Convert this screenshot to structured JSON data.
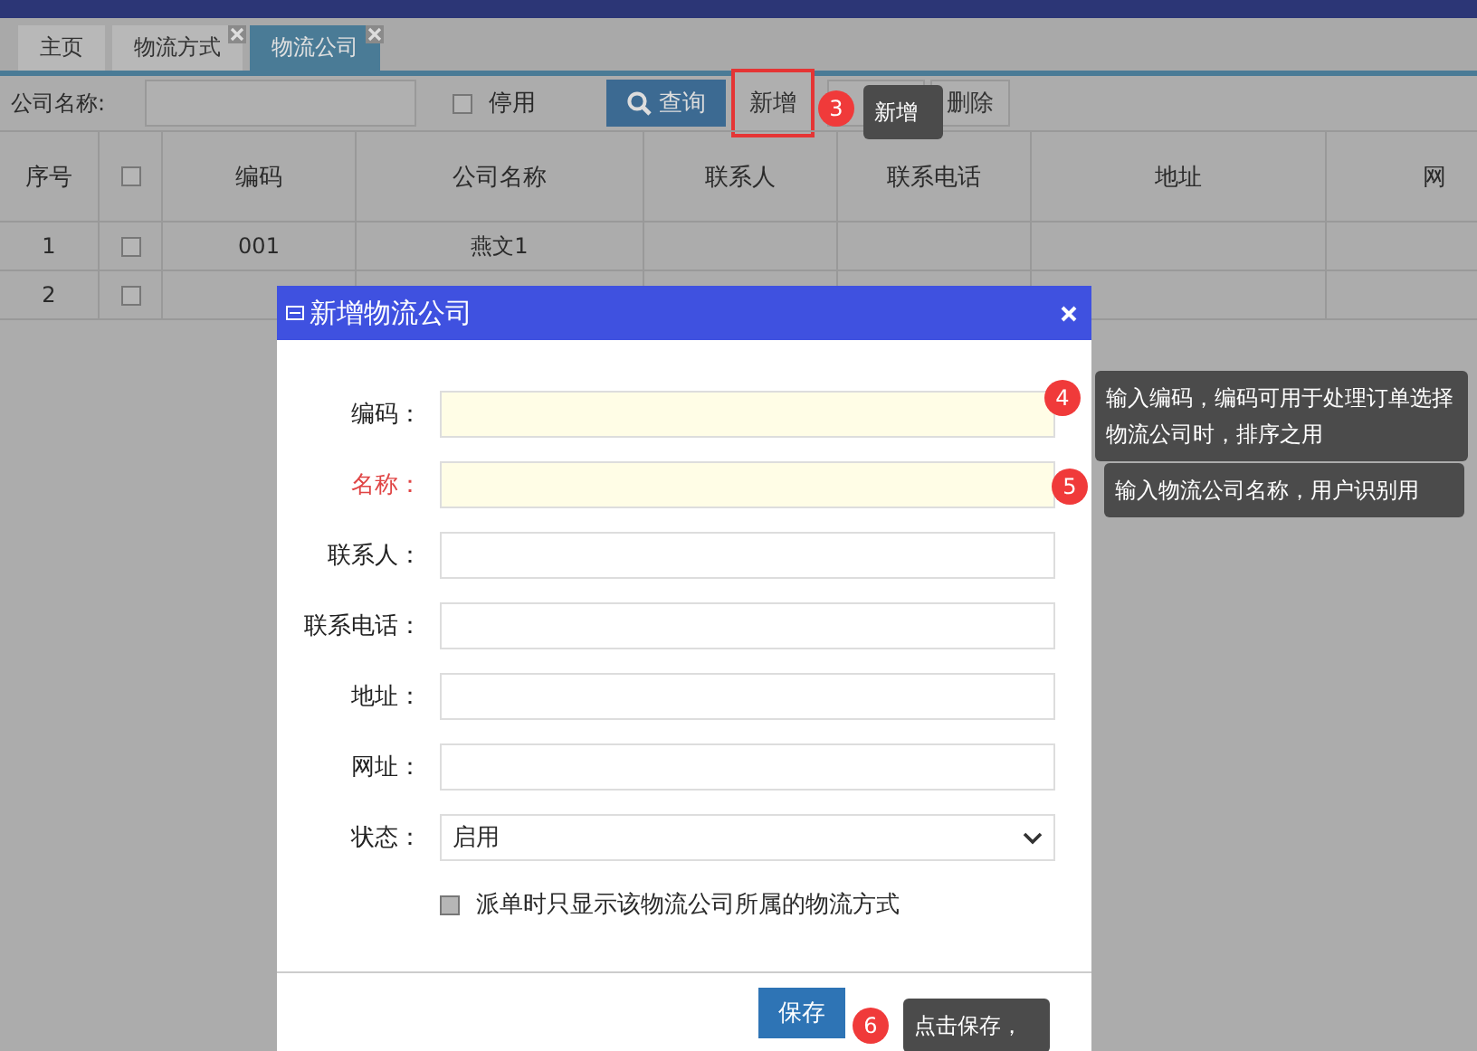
{
  "tabs": [
    {
      "label": "主页",
      "selected": false,
      "closable": false
    },
    {
      "label": "物流方式",
      "selected": false,
      "closable": true
    },
    {
      "label": "物流公司",
      "selected": true,
      "closable": true
    }
  ],
  "toolbar": {
    "name_label": "公司名称:",
    "disabled_filter": {
      "label": "停用",
      "checked": false
    },
    "buttons": [
      {
        "kind": "search",
        "label": "查询",
        "highlighted": false
      },
      {
        "kind": "plain",
        "label": "新增",
        "highlighted": true
      },
      {
        "kind": "blank",
        "highlighted": false
      },
      {
        "kind": "plain",
        "label": "删除",
        "highlighted": false
      }
    ]
  },
  "table": {
    "header_checked": false,
    "columns": [
      "序号",
      "",
      "编码",
      "公司名称",
      "联系人",
      "联系电话",
      "地址",
      "网"
    ],
    "rows": [
      {
        "index": "1",
        "checked": false,
        "code": "001",
        "name": "燕文1"
      },
      {
        "index": "2",
        "checked": false
      }
    ]
  },
  "dialog": {
    "title": "新增物流公司",
    "fields": [
      {
        "kind": "text",
        "label": "编码：",
        "required": false,
        "highlighted": true
      },
      {
        "kind": "text",
        "label": "名称：",
        "required": true,
        "highlighted": true
      },
      {
        "kind": "text",
        "label": "联系人：",
        "required": false,
        "highlighted": false
      },
      {
        "kind": "text",
        "label": "联系电话：",
        "required": false,
        "highlighted": false
      },
      {
        "kind": "text",
        "label": "地址：",
        "required": false,
        "highlighted": false
      },
      {
        "kind": "text",
        "label": "网址：",
        "required": false,
        "highlighted": false
      },
      {
        "kind": "select",
        "label": "状态：",
        "value": "启用",
        "required": false,
        "highlighted": false
      }
    ],
    "option": {
      "label": "派单时只显示该物流公司所属的物流方式",
      "checked": false
    },
    "save_button": "保存"
  },
  "annotations": [
    {
      "number": "3",
      "text": "新增"
    },
    {
      "number": "4",
      "text": "输入编码，编码可用于处理订单选择物流公司时，排序之用"
    },
    {
      "number": "5",
      "text": "输入物流公司名称，用户识别用"
    },
    {
      "number": "6",
      "text": "点击保存，"
    }
  ]
}
